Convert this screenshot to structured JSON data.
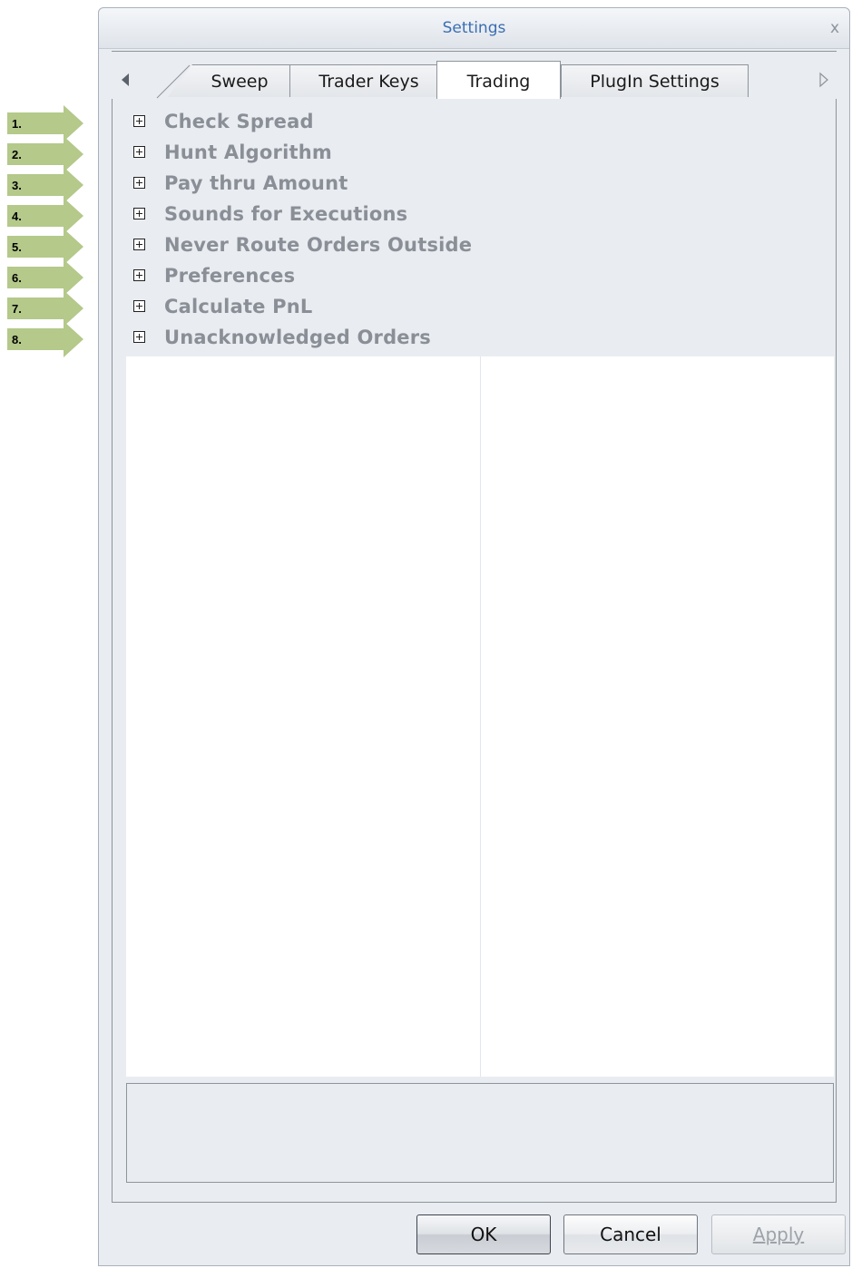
{
  "window": {
    "title": "Settings",
    "close_glyph": "x"
  },
  "tabs": [
    {
      "label": "Sweep",
      "active": false
    },
    {
      "label": "Trader Keys",
      "active": false
    },
    {
      "label": "Trading",
      "active": true
    },
    {
      "label": "PlugIn Settings",
      "active": false
    }
  ],
  "tab_scroll": {
    "left_icon": "triangle-left-icon",
    "right_icon": "triangle-right-icon"
  },
  "callouts": [
    "1.",
    "2.",
    "3.",
    "4.",
    "5.",
    "6.",
    "7.",
    "8."
  ],
  "tree_items": [
    "Check Spread",
    "Hunt Algorithm",
    "Pay thru Amount",
    "Sounds for Executions",
    "Never Route Orders Outside",
    "Preferences",
    "Calculate PnL",
    "Unacknowledged Orders"
  ],
  "buttons": {
    "ok": "OK",
    "cancel": "Cancel",
    "apply": "Apply",
    "apply_enabled": false
  },
  "colors": {
    "callout_arrow": "#b4c98a",
    "title_text": "#3b6eb3",
    "tree_label": "#8a8f97",
    "window_bg": "#e9ecf0"
  }
}
